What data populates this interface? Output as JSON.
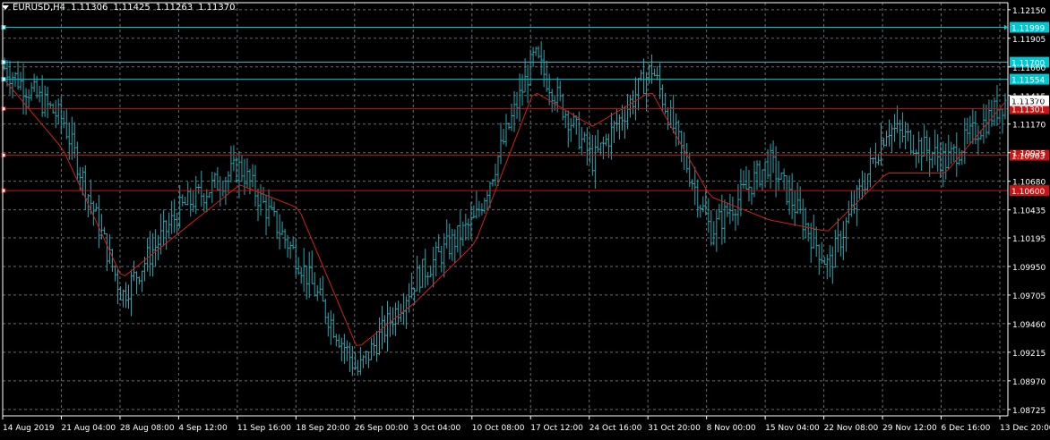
{
  "header": {
    "symbol": "EURUSD,H4",
    "open": "1.11306",
    "high": "1.11425",
    "low": "1.11263",
    "close": "1.11370"
  },
  "colors": {
    "background": "#000000",
    "grid": "#5f6f6f",
    "axis": "#ffffff",
    "bar": "#2aa7b1",
    "ma": "#d21e1e",
    "hline_cyan": "#00c8d2",
    "hline_red": "#c81414"
  },
  "chart_data": {
    "type": "line",
    "ylim": [
      1.0867,
      1.1221
    ],
    "grid": true,
    "y_ticks": [
      "1.12150",
      "1.11905",
      "1.11660",
      "1.11415",
      "1.11170",
      "1.10925",
      "1.10680",
      "1.10435",
      "1.10195",
      "1.09950",
      "1.09705",
      "1.09460",
      "1.09215",
      "1.08970",
      "1.08725"
    ],
    "x_ticks": [
      "14 Aug 2019",
      "21 Aug 04:00",
      "28 Aug 08:00",
      "4 Sep 12:00",
      "11 Sep 16:00",
      "18 Sep 20:00",
      "26 Sep 00:00",
      "3 Oct 04:00",
      "10 Oct 08:00",
      "17 Oct 12:00",
      "24 Oct 16:00",
      "31 Oct 20:00",
      "8 Nov 00:00",
      "15 Nov 04:00",
      "22 Nov 08:00",
      "29 Nov 12:00",
      "6 Dec 16:00",
      "13 Dec 20:00"
    ],
    "price_levels": [
      {
        "value": 1.11999,
        "label": "1.11999",
        "kind": "cyan"
      },
      {
        "value": 1.117,
        "label": "1.11700",
        "kind": "cyan"
      },
      {
        "value": 1.11554,
        "label": "1.11554",
        "kind": "cyan"
      },
      {
        "value": 1.11301,
        "label": "1.11301",
        "kind": "red"
      },
      {
        "value": 1.10903,
        "label": "1.10903",
        "kind": "red"
      },
      {
        "value": 1.106,
        "label": "1.10600",
        "kind": "red"
      }
    ],
    "current_price": {
      "value": 1.1137,
      "label": "1.11370"
    },
    "series": [
      {
        "style": "bars",
        "x": [
          "14 Aug 2019",
          "21 Aug 04:00",
          "28 Aug 08:00",
          "4 Sep 12:00",
          "11 Sep 16:00",
          "18 Sep 20:00",
          "26 Sep 00:00",
          "3 Oct 04:00",
          "10 Oct 08:00",
          "17 Oct 12:00",
          "24 Oct 16:00",
          "31 Oct 20:00",
          "8 Nov 00:00",
          "15 Nov 04:00",
          "22 Nov 08:00",
          "29 Nov 12:00",
          "6 Dec 16:00",
          "13 Dec 20:00"
        ],
        "values": [
          1.1165,
          1.112,
          1.097,
          1.1045,
          1.108,
          1.1,
          1.0905,
          1.0985,
          1.1035,
          1.1175,
          1.1085,
          1.1165,
          1.1025,
          1.1085,
          1.0995,
          1.1115,
          1.1085,
          1.1137
        ]
      },
      {
        "style": "line",
        "x": [
          "14 Aug 2019",
          "21 Aug 04:00",
          "28 Aug 08:00",
          "4 Sep 12:00",
          "11 Sep 16:00",
          "18 Sep 20:00",
          "26 Sep 00:00",
          "3 Oct 04:00",
          "10 Oct 08:00",
          "17 Oct 12:00",
          "24 Oct 16:00",
          "31 Oct 20:00",
          "8 Nov 00:00",
          "15 Nov 04:00",
          "22 Nov 08:00",
          "29 Nov 12:00",
          "6 Dec 16:00",
          "13 Dec 20:00"
        ],
        "values": [
          1.1155,
          1.1095,
          1.0985,
          1.1025,
          1.1065,
          1.1045,
          1.0925,
          1.0965,
          1.1015,
          1.1145,
          1.1115,
          1.1145,
          1.1055,
          1.1035,
          1.1025,
          1.1075,
          1.1075,
          1.1135
        ]
      }
    ]
  }
}
